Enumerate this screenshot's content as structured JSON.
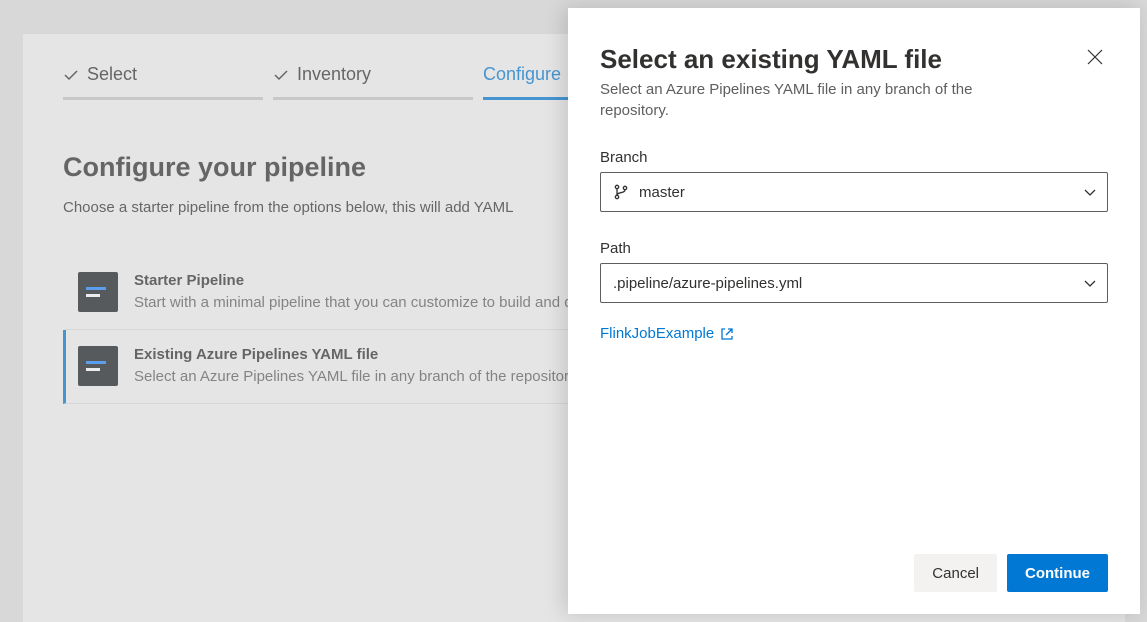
{
  "wizard": {
    "steps": [
      {
        "label": "Select",
        "done": true
      },
      {
        "label": "Inventory",
        "done": true
      },
      {
        "label": "Configure",
        "done": false
      }
    ]
  },
  "page": {
    "title": "Configure your pipeline",
    "subtitle": "Choose a starter pipeline from the options below, this will add YAML"
  },
  "options": [
    {
      "title": "Starter Pipeline",
      "desc": "Start with a minimal pipeline that you can customize to build and deploy your code."
    },
    {
      "title": "Existing Azure Pipelines YAML file",
      "desc": "Select an Azure Pipelines YAML file in any branch of the repository."
    }
  ],
  "modal": {
    "title": "Select an existing YAML file",
    "subtitle": "Select an Azure Pipelines YAML file in any branch of the repository.",
    "branch_label": "Branch",
    "branch_value": "master",
    "path_label": "Path",
    "path_value": ".pipeline/azure-pipelines.yml",
    "link_text": "FlinkJobExample",
    "cancel_label": "Cancel",
    "continue_label": "Continue"
  }
}
